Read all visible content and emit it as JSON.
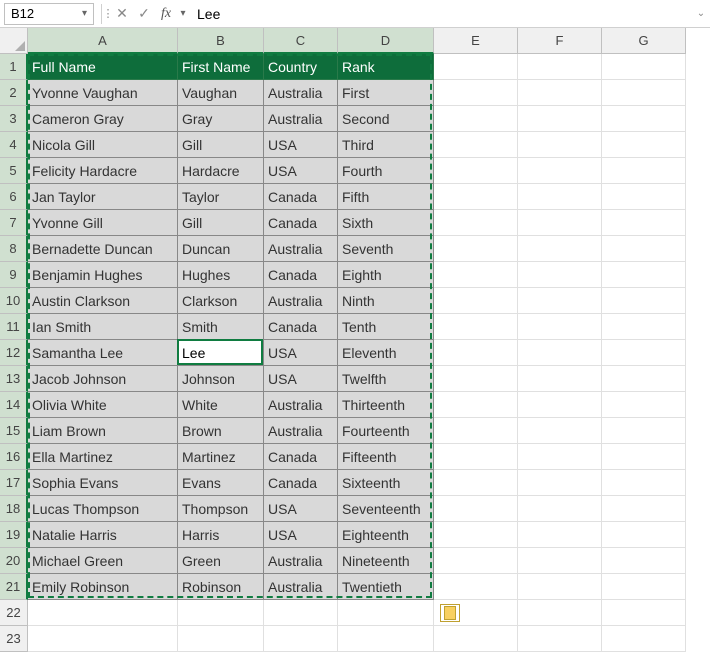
{
  "name_box": "B12",
  "formula_value": "Lee",
  "columns": [
    "A",
    "B",
    "C",
    "D",
    "E",
    "F",
    "G"
  ],
  "headers": {
    "A": "Full Name",
    "B": "First Name",
    "C": "Country",
    "D": "Rank"
  },
  "rows": [
    {
      "n": 2,
      "A": "Yvonne Vaughan",
      "B": "Vaughan",
      "C": "Australia",
      "D": "First"
    },
    {
      "n": 3,
      "A": "Cameron Gray",
      "B": "Gray",
      "C": "Australia",
      "D": "Second"
    },
    {
      "n": 4,
      "A": "Nicola Gill",
      "B": "Gill",
      "C": "USA",
      "D": "Third"
    },
    {
      "n": 5,
      "A": "Felicity Hardacre",
      "B": "Hardacre",
      "C": "USA",
      "D": "Fourth"
    },
    {
      "n": 6,
      "A": "Jan Taylor",
      "B": "Taylor",
      "C": "Canada",
      "D": "Fifth"
    },
    {
      "n": 7,
      "A": "Yvonne Gill",
      "B": "Gill",
      "C": "Canada",
      "D": "Sixth"
    },
    {
      "n": 8,
      "A": "Bernadette Duncan",
      "B": "Duncan",
      "C": "Australia",
      "D": "Seventh"
    },
    {
      "n": 9,
      "A": "Benjamin Hughes",
      "B": "Hughes",
      "C": "Canada",
      "D": "Eighth"
    },
    {
      "n": 10,
      "A": "Austin Clarkson",
      "B": "Clarkson",
      "C": "Australia",
      "D": "Ninth"
    },
    {
      "n": 11,
      "A": "Ian Smith",
      "B": "Smith",
      "C": "Canada",
      "D": "Tenth"
    },
    {
      "n": 12,
      "A": "Samantha Lee",
      "B": "Lee",
      "C": "USA",
      "D": "Eleventh"
    },
    {
      "n": 13,
      "A": "Jacob Johnson",
      "B": "Johnson",
      "C": "USA",
      "D": "Twelfth"
    },
    {
      "n": 14,
      "A": "Olivia White",
      "B": "White",
      "C": "Australia",
      "D": "Thirteenth"
    },
    {
      "n": 15,
      "A": "Liam Brown",
      "B": "Brown",
      "C": "Australia",
      "D": "Fourteenth"
    },
    {
      "n": 16,
      "A": "Ella Martinez",
      "B": "Martinez",
      "C": "Canada",
      "D": "Fifteenth"
    },
    {
      "n": 17,
      "A": "Sophia Evans",
      "B": "Evans",
      "C": "Canada",
      "D": "Sixteenth"
    },
    {
      "n": 18,
      "A": "Lucas Thompson",
      "B": "Thompson",
      "C": "USA",
      "D": "Seventeenth"
    },
    {
      "n": 19,
      "A": "Natalie Harris",
      "B": "Harris",
      "C": "USA",
      "D": "Eighteenth"
    },
    {
      "n": 20,
      "A": "Michael Green",
      "B": "Green",
      "C": "Australia",
      "D": "Nineteenth"
    },
    {
      "n": 21,
      "A": "Emily Robinson",
      "B": "Robinson",
      "C": "Australia",
      "D": "Twentieth"
    }
  ],
  "active_cell": {
    "row": 12,
    "col": "B"
  },
  "selection_rows": 21,
  "selection_cols": 4,
  "extra_rows": [
    22,
    23
  ]
}
